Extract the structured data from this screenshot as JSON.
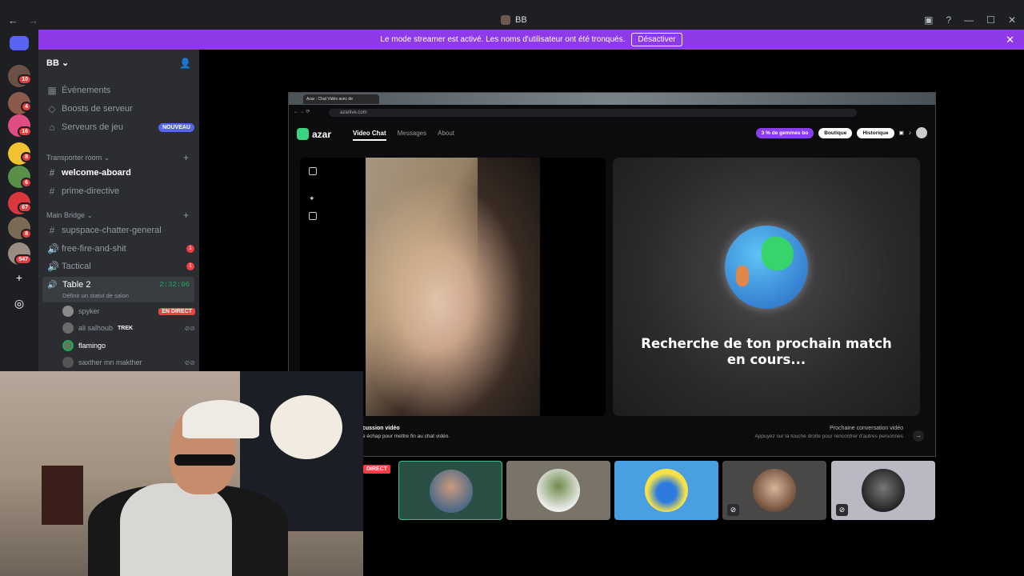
{
  "window": {
    "title": "BB"
  },
  "banner": {
    "text": "Le mode streamer est activé. Les noms d'utilisateur ont été tronqués.",
    "button": "Désactiver"
  },
  "rail": {
    "badges": [
      "10",
      "4",
      "16",
      "8",
      "6",
      "67",
      "8",
      "547"
    ]
  },
  "sidebar": {
    "guild_name": "BB",
    "top_items": [
      {
        "icon": "calendar-icon",
        "label": "Événements"
      },
      {
        "icon": "boost-icon",
        "label": "Boosts de serveur"
      },
      {
        "icon": "gamepad-icon",
        "label": "Serveurs de jeu",
        "badge": "NOUVEAU"
      }
    ],
    "categories": [
      {
        "name": "Transporter room",
        "channels": [
          {
            "type": "text",
            "label": "welcome-aboard",
            "active": true
          },
          {
            "type": "text",
            "label": "prime-directive"
          }
        ]
      },
      {
        "name": "Main Bridge",
        "channels": [
          {
            "type": "text",
            "label": "supspace-chatter-general"
          },
          {
            "type": "voice",
            "label": "free-fire-and-shit",
            "badge": "1"
          },
          {
            "type": "voice",
            "label": "Tactical",
            "badge": "1"
          }
        ]
      }
    ],
    "voice_channel": {
      "name": "Table 2",
      "timer": "2:32:06",
      "status": "Définir un statut de salon"
    },
    "members": [
      {
        "name": "spyker",
        "tag": "EN DIRECT"
      },
      {
        "name": "ali salhoub",
        "tag": "TREK"
      },
      {
        "name": "flamingo"
      },
      {
        "name": "saxther mn makther"
      }
    ]
  },
  "browser": {
    "tab_title": "Azar : Chat Vidéo avec de",
    "url": "azarlive.com",
    "brand": "azar",
    "nav": [
      "Video Chat",
      "Messages",
      "About"
    ],
    "gems_pill": "3 % de gemmes bo",
    "shop_pill": "Boutique",
    "history_pill": "Historique",
    "search_text": "Recherche de ton prochain match en cours...",
    "footer_left_title": "cussion vidéo",
    "footer_left_sub": "e échap pour mettre fin au chat vidéo.",
    "footer_right_title": "Prochaine conversation vidéo",
    "footer_right_sub": "Appuyez sur la touche droite pour rencontrer d'autres personnes"
  },
  "stage": {
    "live_tag": "DIRECT"
  }
}
